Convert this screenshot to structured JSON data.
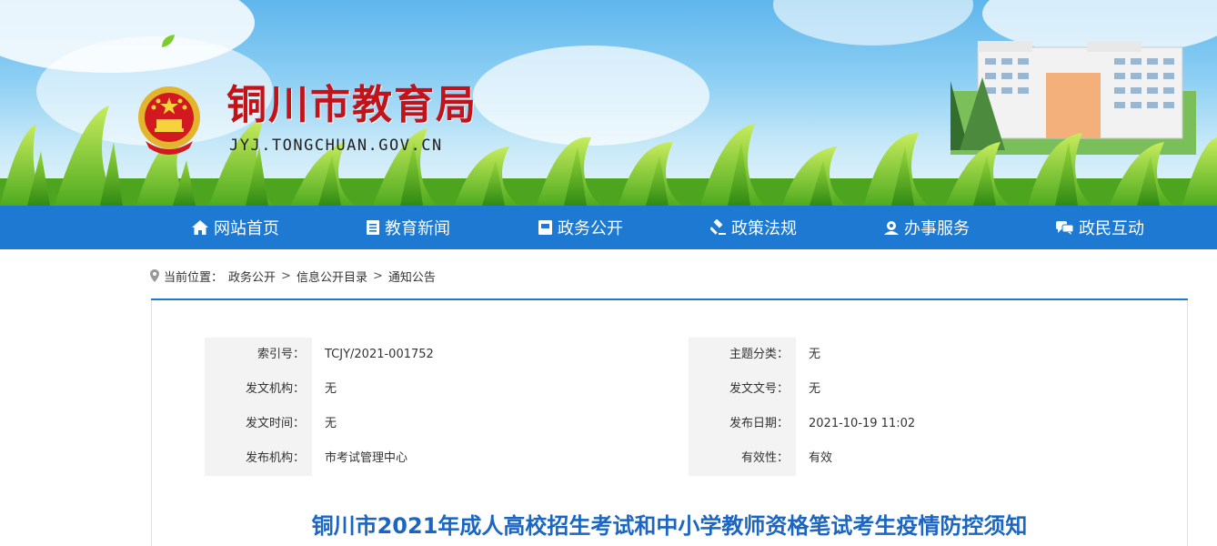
{
  "header": {
    "title": "铜川市教育局",
    "domain": "JYJ.TONGCHUAN.GOV.CN"
  },
  "nav": [
    {
      "label": "网站首页",
      "icon": "home-icon"
    },
    {
      "label": "教育新闻",
      "icon": "news-icon"
    },
    {
      "label": "政务公开",
      "icon": "book-icon"
    },
    {
      "label": "政策法规",
      "icon": "gavel-icon"
    },
    {
      "label": "办事服务",
      "icon": "user-service-icon"
    },
    {
      "label": "政民互动",
      "icon": "chat-icon"
    }
  ],
  "breadcrumb": {
    "prefix": "当前位置：",
    "items": [
      "政务公开",
      "信息公开目录",
      "通知公告"
    ],
    "separator": ">"
  },
  "meta": {
    "left": [
      {
        "label": "索引号：",
        "value": "TCJY/2021-001752"
      },
      {
        "label": "发文机构：",
        "value": "无"
      },
      {
        "label": "发文时间：",
        "value": "无"
      },
      {
        "label": "发布机构：",
        "value": "市考试管理中心"
      }
    ],
    "right": [
      {
        "label": "主题分类：",
        "value": "无"
      },
      {
        "label": "发文文号：",
        "value": "无"
      },
      {
        "label": "发布日期：",
        "value": "2021-10-19 11:02"
      },
      {
        "label": "有效性：",
        "value": "有效"
      }
    ]
  },
  "article": {
    "title": "铜川市2021年成人高校招生考试和中小学教师资格笔试考生疫情防控须知"
  },
  "colors": {
    "nav_bg": "#1e79d2",
    "title_red": "#c2131a",
    "article_title": "#1a66c2"
  }
}
